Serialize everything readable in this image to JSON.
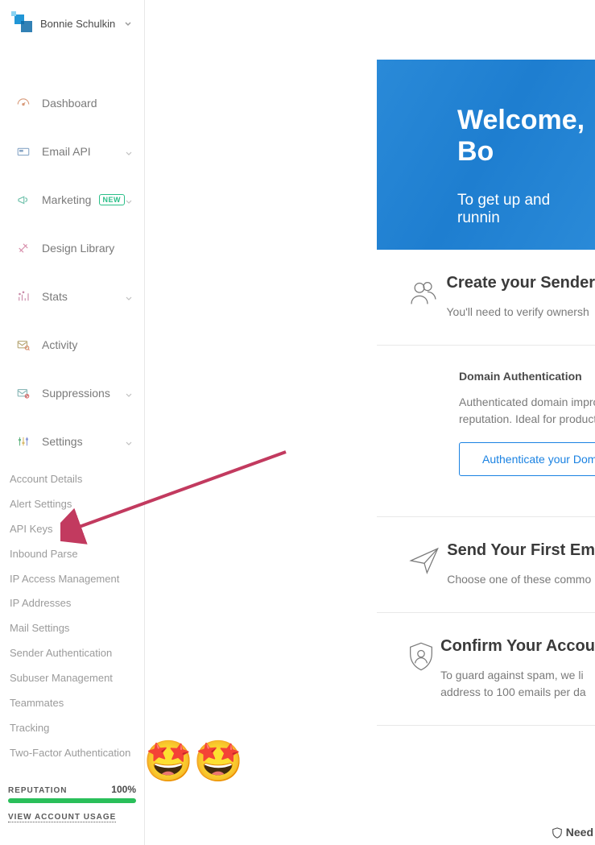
{
  "user": {
    "name": "Bonnie Schulkin"
  },
  "nav": {
    "dashboard": "Dashboard",
    "email_api": "Email API",
    "marketing": "Marketing",
    "marketing_badge": "NEW",
    "design_library": "Design Library",
    "stats": "Stats",
    "activity": "Activity",
    "suppressions": "Suppressions",
    "settings": "Settings"
  },
  "settings_items": [
    "Account Details",
    "Alert Settings",
    "API Keys",
    "Inbound Parse",
    "IP Access Management",
    "IP Addresses",
    "Mail Settings",
    "Sender Authentication",
    "Subuser Management",
    "Teammates",
    "Tracking",
    "Two-Factor Authentication"
  ],
  "reputation": {
    "label": "REPUTATION",
    "value": "100%"
  },
  "usage_link": "VIEW ACCOUNT USAGE",
  "hero": {
    "title": "Welcome, Bo",
    "subtitle": "To get up and runnin"
  },
  "cards": {
    "sender": {
      "title": "Create your Sender",
      "sub": "You'll need to verify ownersh"
    },
    "domain": {
      "title": "Domain Authentication",
      "body": "Authenticated domain impro\nreputation. Ideal for producti",
      "btn": "Authenticate your Dom"
    },
    "send": {
      "title": "Send Your First Em",
      "sub": "Choose one of these commo"
    },
    "confirm": {
      "title": "Confirm Your Accou",
      "sub": "To guard against spam, we li\naddress to 100 emails per da"
    }
  },
  "footer": "Need",
  "emoji": "🤩🤩"
}
